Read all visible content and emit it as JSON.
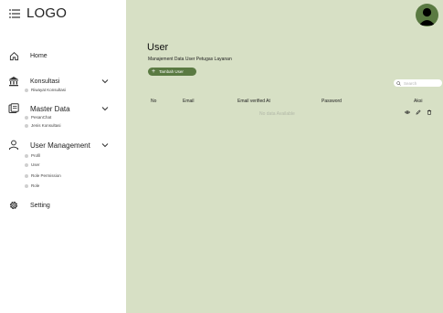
{
  "app": {
    "logo": "LOGO"
  },
  "sidebar": {
    "items": [
      {
        "label": "Home",
        "subitems": []
      },
      {
        "label": "Konsultasi",
        "subitems": [
          "Riwayat Konsultasi"
        ]
      },
      {
        "label": "Master Data",
        "subitems": [
          "PesanChat",
          "Jenis Konsultasi"
        ]
      },
      {
        "label": "User Management",
        "subitems": [
          "Profil",
          "User",
          "Role Permission",
          "Role"
        ]
      },
      {
        "label": "Setting",
        "subitems": []
      }
    ]
  },
  "main": {
    "title": "User",
    "subtitle": "Manajement Data User Petugas Layanan",
    "add_button": "Tambah User",
    "search_placeholder": "Search",
    "table": {
      "columns": [
        "No",
        "Email",
        "Email verified At",
        "Password",
        "Aksi"
      ],
      "empty_text": "No data Available"
    }
  },
  "colors": {
    "accent": "#5a7a42",
    "main_bg": "#d7e0c5"
  }
}
